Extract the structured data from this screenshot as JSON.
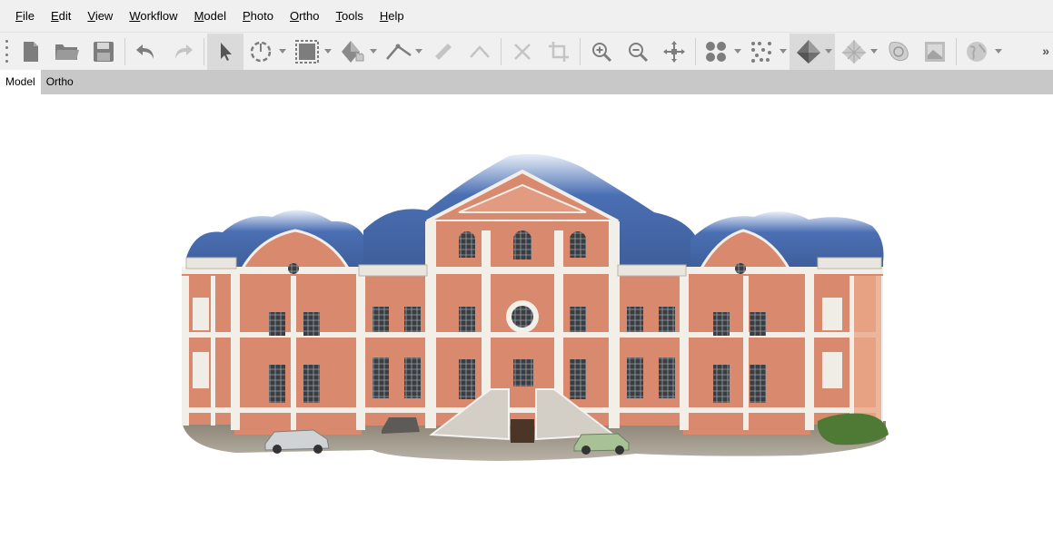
{
  "menubar": {
    "items": [
      {
        "first": "F",
        "rest": "ile"
      },
      {
        "first": "E",
        "rest": "dit"
      },
      {
        "first": "V",
        "rest": "iew"
      },
      {
        "first": "W",
        "rest": "orkflow"
      },
      {
        "first": "M",
        "rest": "odel"
      },
      {
        "first": "P",
        "rest": "hoto"
      },
      {
        "first": "O",
        "rest": "rtho"
      },
      {
        "first": "T",
        "rest": "ools"
      },
      {
        "first": "H",
        "rest": "elp"
      }
    ]
  },
  "toolbar": {
    "icons": [
      "new-document-icon",
      "open-folder-icon",
      "save-disk-icon",
      "undo-icon",
      "redo-icon",
      "select-arrow-icon",
      "rotate-selection-icon",
      "rectangle-selection-icon",
      "navigation-hand-icon",
      "ruler-measure-icon",
      "eraser-icon",
      "angle-icon",
      "delete-x-icon",
      "crop-icon",
      "zoom-in-icon",
      "zoom-out-icon",
      "reset-view-icon",
      "point-cloud-icon",
      "dense-cloud-icon",
      "solid-model-icon",
      "wireframe-model-icon",
      "tiled-model-icon",
      "texture-icon",
      "globe-icon"
    ],
    "overflow_label": "»"
  },
  "tabs": [
    "Model",
    "Ortho"
  ],
  "colors": {
    "facade_salmon": "#d98a6e",
    "facade_white": "#f2efe9",
    "roof_blue": "#4a6fb3",
    "toolbar_bg": "#f0f0f0",
    "tabbar_bg": "#c8c8c8"
  }
}
